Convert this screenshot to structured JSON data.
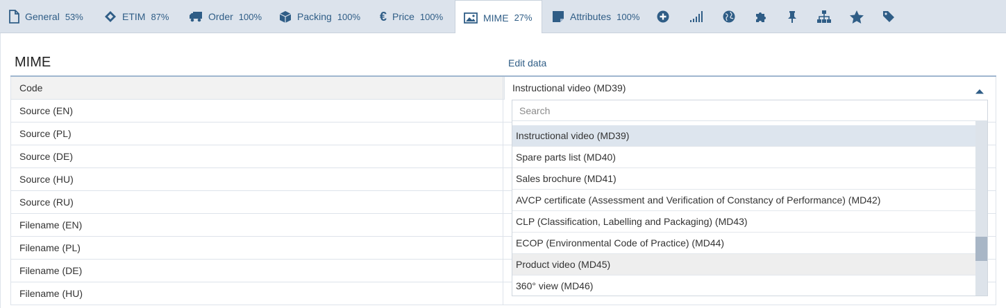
{
  "tabs": [
    {
      "label": "General",
      "percent": "53%",
      "icon": "document-icon"
    },
    {
      "label": "ETIM",
      "percent": "87%",
      "icon": "etim-diamond-icon"
    },
    {
      "label": "Order",
      "percent": "100%",
      "icon": "truck-icon"
    },
    {
      "label": "Packing",
      "percent": "100%",
      "icon": "box-icon"
    },
    {
      "label": "Price",
      "percent": "100%",
      "icon": "euro-icon"
    },
    {
      "label": "MIME",
      "percent": "27%",
      "icon": "image-icon",
      "active": true
    },
    {
      "label": "Attributes",
      "percent": "100%",
      "icon": "sticky-note-icon"
    }
  ],
  "icon_tabs": [
    "plus-circle-icon",
    "signal-bars-icon",
    "globe-icon",
    "puzzle-icon",
    "pin-icon",
    "sitemap-icon",
    "star-icon",
    "tag-icon"
  ],
  "section": {
    "title": "MIME",
    "edit_link": "Edit data"
  },
  "rows": [
    {
      "label": "Code"
    },
    {
      "label": "Source (EN)"
    },
    {
      "label": "Source (PL)"
    },
    {
      "label": "Source (DE)"
    },
    {
      "label": "Source (HU)"
    },
    {
      "label": "Source (RU)"
    },
    {
      "label": "Filename (EN)"
    },
    {
      "label": "Filename (PL)"
    },
    {
      "label": "Filename (DE)"
    },
    {
      "label": "Filename (HU)"
    }
  ],
  "code_select": {
    "value": "Instructional video (MD39)",
    "search_placeholder": "Search",
    "options": [
      "Instructional video (MD39)",
      "Spare parts list (MD40)",
      "Sales brochure (MD41)",
      "AVCP certificate (Assessment and Verification of Constancy of Performance) (MD42)",
      "CLP (Classification, Labelling and Packaging) (MD43)",
      "ECOP (Environmental Code of Practice) (MD44)",
      "Product video (MD45)",
      "360° view (MD46)"
    ],
    "selected_option": "Instructional video (MD39)",
    "hovered_option": "Product video (MD45)"
  },
  "colors": {
    "accent": "#2f5d86",
    "tabbar": "#dce3ec",
    "selected": "#dde5ee",
    "hover": "#eeeeee"
  }
}
